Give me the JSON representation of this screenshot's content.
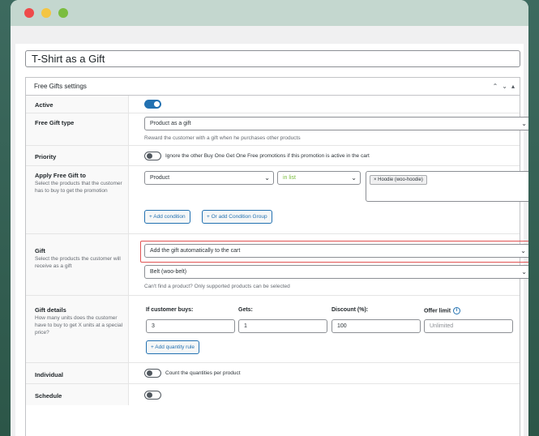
{
  "window": {
    "controls": [
      "close",
      "minimize",
      "maximize"
    ]
  },
  "post_title": "T-Shirt as a Gift",
  "box": {
    "title": "Free Gifts settings"
  },
  "active": {
    "label": "Active",
    "enabled": true
  },
  "gift_type": {
    "label": "Free Gift type",
    "value": "Product as a gift",
    "help": "Reward the customer with a gift when he purchases other products"
  },
  "priority": {
    "label": "Priority",
    "enabled": false,
    "text": "Ignore the other Buy One Get One Free promotions if this promotion is active in the cart"
  },
  "apply": {
    "label": "Apply Free Gift to",
    "sub": "Select the products that the customer has to buy to get the promotion",
    "field": "Product",
    "operator": "in list",
    "chip": "× Hoodie (woo-hoodie)",
    "add_condition": "+ Add condition",
    "add_group": "+ Or add Condition Group"
  },
  "gift": {
    "label": "Gift",
    "sub": "Select the products the customer will receive as a gift",
    "mode": "Add the gift automatically to the cart",
    "product": "Belt (woo-belt)",
    "help": "Can't find a product? Only supported products can be selected"
  },
  "details": {
    "label": "Gift details",
    "sub": "How many units does the customer have to buy to get X units at a special price?",
    "headers": {
      "buys": "If customer buys:",
      "gets": "Gets:",
      "discount": "Discount (%):",
      "limit": "Offer limit"
    },
    "values": {
      "buys": "3",
      "gets": "1",
      "discount": "100",
      "limit": "Unlimited"
    },
    "add_rule": "+ Add quantity rule"
  },
  "individual": {
    "label": "Individual",
    "enabled": false,
    "text": "Count the quantities per product"
  },
  "schedule": {
    "label": "Schedule",
    "enabled": false
  },
  "colors": {
    "accent": "#2271b1",
    "highlight": "#e15252"
  }
}
